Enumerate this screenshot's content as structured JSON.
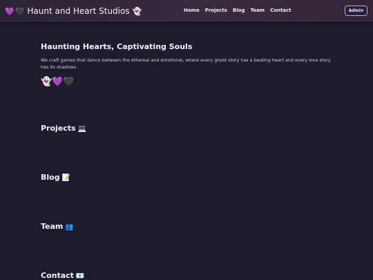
{
  "header": {
    "brand": {
      "prefix_icons": [
        "💜",
        "🖤"
      ],
      "title": "Haunt and Heart Studios",
      "suffix_icon": "👻"
    },
    "nav": [
      {
        "label": "Home"
      },
      {
        "label": "Projects"
      },
      {
        "label": "Blog"
      },
      {
        "label": "Team"
      },
      {
        "label": "Contact"
      }
    ],
    "admin_label": "Admin"
  },
  "hero": {
    "title": "Haunting Hearts, Captivating Souls",
    "description": "We craft games that dance between the ethereal and emotional, where every ghost story has a beating heart and every love story has its shadows.",
    "emojis": "👻💜🖤"
  },
  "sections": {
    "projects": {
      "title": "Projects",
      "emoji": "💻"
    },
    "blog": {
      "title": "Blog",
      "emoji": "📝"
    },
    "team": {
      "title": "Team",
      "emoji": "👥"
    },
    "contact": {
      "title": "Contact",
      "emoji": "📧"
    }
  },
  "colors": {
    "background": "#1e1c2c",
    "header": "#3a2a3e",
    "accent_border": "#b8aaf0"
  }
}
